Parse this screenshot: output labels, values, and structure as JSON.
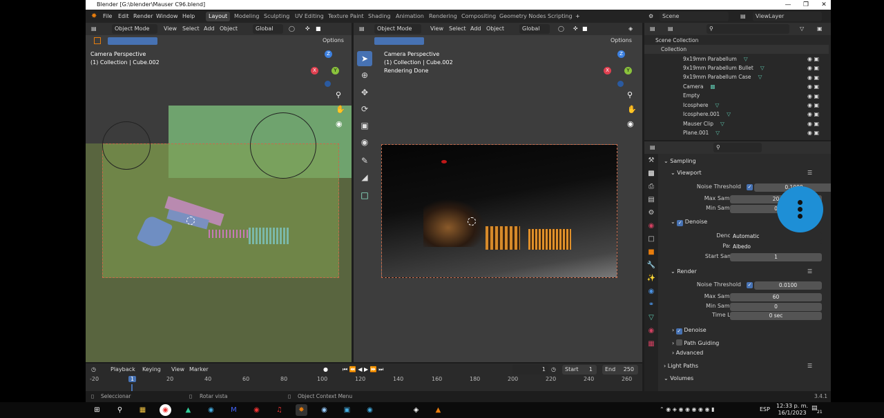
{
  "window": {
    "title": "Blender [G:\\blender\\Mauser C96.blend]"
  },
  "menu": {
    "file": "File",
    "edit": "Edit",
    "render": "Render",
    "window": "Window",
    "help": "Help"
  },
  "workspaces": [
    "Layout",
    "Modeling",
    "Sculpting",
    "UV Editing",
    "Texture Paint",
    "Shading",
    "Animation",
    "Rendering",
    "Compositing",
    "Geometry Nodes",
    "Scripting"
  ],
  "add_workspace": "+",
  "scene": {
    "name": "Scene",
    "view_layer": "ViewLayer"
  },
  "viewport_left": {
    "mode": "Object Mode",
    "view": "View",
    "select": "Select",
    "add": "Add",
    "object": "Object",
    "orientation": "Global",
    "options": "Options",
    "overlay_line1": "Camera Perspective",
    "overlay_line2": "(1) Collection | Cube.002"
  },
  "viewport_right": {
    "mode": "Object Mode",
    "view": "View",
    "select": "Select",
    "add": "Add",
    "object": "Object",
    "orientation": "Global",
    "options": "Options",
    "overlay_line1": "Camera Perspective",
    "overlay_line2": "(1) Collection | Cube.002",
    "overlay_line3": "Rendering Done"
  },
  "gizmo": {
    "x": "X",
    "y": "Y",
    "z": "Z"
  },
  "outliner": {
    "root": "Scene Collection",
    "collection": "Collection",
    "items": [
      "9x19mm Parabellum",
      "9x19mm Parabellum Bullet",
      "9x19mm Parabellum Case",
      "Camera",
      "Empty",
      "Icosphere",
      "Icosphere.001",
      "Mauser Clip",
      "Plane.001"
    ]
  },
  "properties": {
    "sampling": "Sampling",
    "viewport": "Viewport",
    "noise_threshold_label": "Noise Threshold",
    "viewport_noise_threshold": "0.1000",
    "max_samples_label": "Max Samples",
    "viewport_max_samples": "20",
    "min_samples_label": "Min Samples",
    "viewport_min_samples": "0",
    "denoise": "Denoise",
    "denoiser_label": "Denoiser",
    "denoiser_value": "Automatic",
    "passes_label": "Passes",
    "passes_value": "Albedo",
    "start_sample_label": "Start Sample",
    "start_sample_value": "1",
    "render": "Render",
    "render_noise_threshold": "0.0100",
    "render_max_samples": "60",
    "render_min_samples": "0",
    "time_limit_label": "Time Limit",
    "time_limit_value": "0 sec",
    "render_denoise": "Denoise",
    "path_guiding": "Path Guiding",
    "advanced": "Advanced",
    "light_paths": "Light Paths",
    "volumes": "Volumes"
  },
  "timeline": {
    "playback": "Playback",
    "keying": "Keying",
    "view": "View",
    "marker": "Marker",
    "current_frame": "1",
    "start_label": "Start",
    "start": "1",
    "end_label": "End",
    "end": "250",
    "ticks": [
      "-20",
      "1",
      "20",
      "40",
      "60",
      "80",
      "100",
      "120",
      "140",
      "160",
      "180",
      "200",
      "220",
      "240",
      "260"
    ]
  },
  "statusbar": {
    "select": "Seleccionar",
    "rotate": "Rotar vista",
    "context": "Object Context Menu",
    "version": "3.4.1"
  },
  "taskbar": {
    "lang": "ESP",
    "time": "12:33 p. m.",
    "date": "16/1/2023",
    "notif": "21"
  },
  "colors": {
    "accent": "#4772b3",
    "blender_orange": "#e87d0d",
    "overlay_blue": "#1e8fd6"
  }
}
